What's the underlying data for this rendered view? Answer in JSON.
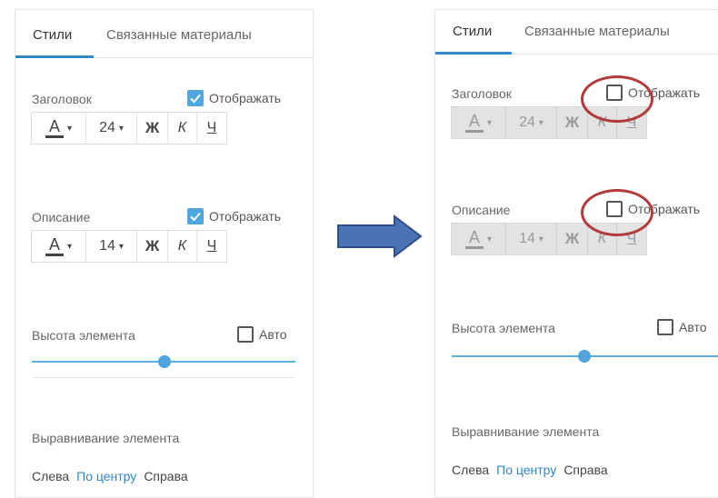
{
  "left": {
    "tabs": [
      "Стили",
      "Связанные материалы"
    ],
    "heading": {
      "label": "Заголовок",
      "show_label": "Отображать",
      "checked": true,
      "font_size": "24"
    },
    "description": {
      "label": "Описание",
      "show_label": "Отображать",
      "checked": true,
      "font_size": "14"
    },
    "height": {
      "label": "Высота элемента",
      "auto_label": "Авто",
      "auto_checked": false
    },
    "align": {
      "label": "Выравнивание элемента",
      "options": [
        "Слева",
        "По центру",
        "Справа"
      ],
      "selected": "По центру"
    }
  },
  "right": {
    "tabs": [
      "Стили",
      "Связанные материалы"
    ],
    "heading": {
      "label": "Заголовок",
      "show_label": "Отображать",
      "checked": false,
      "font_size": "24"
    },
    "description": {
      "label": "Описание",
      "show_label": "Отображать",
      "checked": false,
      "font_size": "14"
    },
    "height": {
      "label": "Высота элемента",
      "auto_label": "Авто",
      "auto_checked": false
    },
    "align": {
      "label": "Выравнивание элемента",
      "options": [
        "Слева",
        "По центру",
        "Справа"
      ],
      "selected": "По центру"
    }
  },
  "toolbar": {
    "color_letter": "А",
    "bold": "Ж",
    "italic": "К",
    "underline": "Ч",
    "caret": "▾"
  },
  "icons": {
    "check": "check-icon",
    "arrow": "arrow-right-icon",
    "highlight": "red-circle-highlight"
  },
  "colors": {
    "accent": "#2f8bc9",
    "checkbox_on": "#4fa7e0",
    "highlight": "#b23a3a",
    "arrow_fill": "#4a72b5",
    "arrow_stroke": "#2f4f86"
  }
}
